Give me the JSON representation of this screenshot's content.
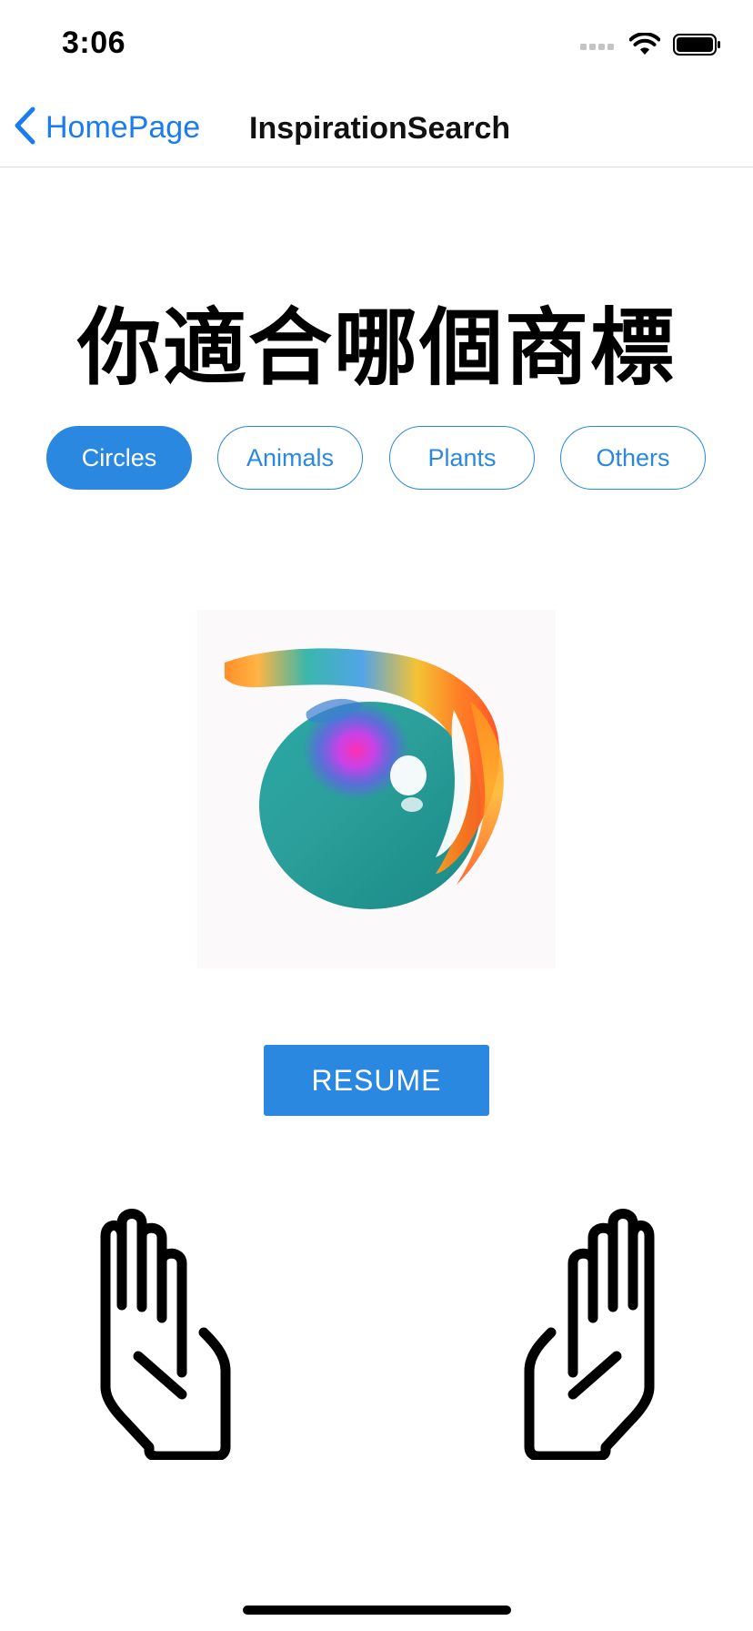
{
  "status_bar": {
    "time": "3:06",
    "signal_icon": "signal-dots-icon",
    "wifi_icon": "wifi-icon",
    "battery_icon": "battery-icon"
  },
  "nav": {
    "back_label": "HomePage",
    "back_icon": "chevron-left-icon",
    "title": "InspirationSearch"
  },
  "headline": "你適合哪個商標",
  "categories": [
    {
      "label": "Circles",
      "active": true
    },
    {
      "label": "Animals",
      "active": false
    },
    {
      "label": "Plants",
      "active": false
    },
    {
      "label": "Others",
      "active": false
    }
  ],
  "logo": {
    "icon": "gradient-swirl-logo-icon"
  },
  "resume_label": "RESUME",
  "gestures": {
    "left_icon": "left-hand-icon",
    "right_icon": "right-hand-icon"
  },
  "colors": {
    "accent": "#2a88e0",
    "link": "#1a7cf0",
    "text": "#000000",
    "background": "#ffffff"
  }
}
